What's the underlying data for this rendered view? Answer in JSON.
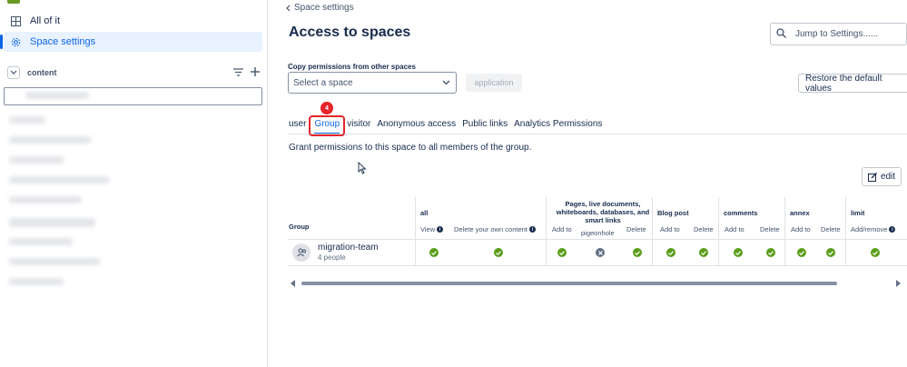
{
  "sidebar": {
    "items": [
      {
        "label": "All of it",
        "icon": "grid-icon"
      },
      {
        "label": "Space settings",
        "icon": "gear-icon"
      }
    ],
    "content_label": "content"
  },
  "main": {
    "back_label": "Space settings",
    "title": "Access to spaces",
    "jump_placeholder": "Jump to Settings......",
    "copy_label": "Copy permissions from other spaces",
    "select_value": "Select a space",
    "apply_label": "application",
    "restore_label": "Restore the default values",
    "tabs": [
      "user",
      "Group",
      "visitor",
      "Anonymous access",
      "Public links",
      "Analytics Permissions"
    ],
    "selected_tab": "Group",
    "step_badge": "4",
    "description": "Grant permissions to this space to all members of the group.",
    "edit_label": "edit"
  },
  "table": {
    "group_header": "Group",
    "categories": [
      {
        "name": "all",
        "subs": [
          "View",
          "Delete your own content"
        ]
      },
      {
        "name": "Pages, live documents, whiteboards, databases, and smart links",
        "subs": [
          "Add to",
          "pigeonhole",
          "Delete"
        ]
      },
      {
        "name": "Blog post",
        "subs": [
          "Add to",
          "Delete"
        ]
      },
      {
        "name": "comments",
        "subs": [
          "Add to",
          "Delete"
        ]
      },
      {
        "name": "annex",
        "subs": [
          "Add to",
          "Delete"
        ]
      },
      {
        "name": "limit",
        "subs": [
          "Add/remove"
        ]
      }
    ],
    "rows": [
      {
        "name": "migration-team",
        "count": "4 people",
        "perms": [
          true,
          true,
          true,
          false,
          true,
          true,
          true,
          true,
          true,
          true,
          true,
          true
        ]
      }
    ]
  },
  "colors": {
    "accent": "#0c66e4",
    "check": "#5b9d1b",
    "highlight": "#e5252a"
  }
}
